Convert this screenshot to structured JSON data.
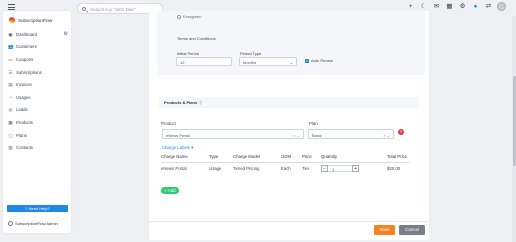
{
  "search": {
    "placeholder": "Search e.g \"John Doe\""
  },
  "topbar": {
    "icons": [
      "plus-icon",
      "moon-icon",
      "mail-icon",
      "calendar-icon",
      "gear-icon",
      "notification-icon",
      "translate-icon",
      "user-avatar"
    ]
  },
  "sidebar": {
    "brand": "SubscriptionFlow",
    "items": [
      {
        "label": "Dashboard",
        "icon": "dashboard-icon"
      },
      {
        "label": "Customers",
        "icon": "customers-icon"
      },
      {
        "label": "Coupons",
        "icon": "coupons-icon"
      },
      {
        "label": "Subscriptions",
        "icon": "subscriptions-icon"
      },
      {
        "label": "Invoices",
        "icon": "invoices-icon"
      },
      {
        "label": "Usages",
        "icon": "usages-icon"
      },
      {
        "label": "Leads",
        "icon": "leads-icon"
      },
      {
        "label": "Products",
        "icon": "products-icon"
      },
      {
        "label": "Plans",
        "icon": "plans-icon"
      },
      {
        "label": "Contacts",
        "icon": "contacts-icon"
      }
    ],
    "help_label": "Need Help?",
    "admin_label": "SubscriptionFlow Admin"
  },
  "form": {
    "radio_label": "Evergreen",
    "terms_label": "Terms and Conditions",
    "initial_period_label": "Initial Period",
    "initial_period_value": "12",
    "period_type_label": "Period Type",
    "period_type_value": "Months",
    "auto_renew_label": "Auto Renew",
    "auto_renew_checked": true
  },
  "products_plans": {
    "title": "Products & Plans",
    "product_label": "Product",
    "product_value": "eNews Portal",
    "plan_label": "Plan",
    "plan_value": "Basic",
    "charge_labels_link": "Charge Labels",
    "table": {
      "headers": [
        "Charge Name",
        "Type",
        "Charge Model",
        "UOM",
        "Price",
        "Quantity",
        "Total Price"
      ],
      "rows": [
        {
          "charge_name": "eNews Portal",
          "type": "Usage",
          "charge_model": "Tiered Pricing",
          "uom": "Each",
          "price": "Tier",
          "quantity": "1",
          "total_price": "$20.00"
        }
      ]
    },
    "add_label": "+ Add"
  },
  "footer": {
    "save_label": "Save",
    "cancel_label": "Cancel"
  },
  "colors": {
    "primary": "#1e88e5",
    "save": "#f58220",
    "cancel": "#7a7e87",
    "add": "#2ecc71",
    "remove": "#e53935"
  }
}
